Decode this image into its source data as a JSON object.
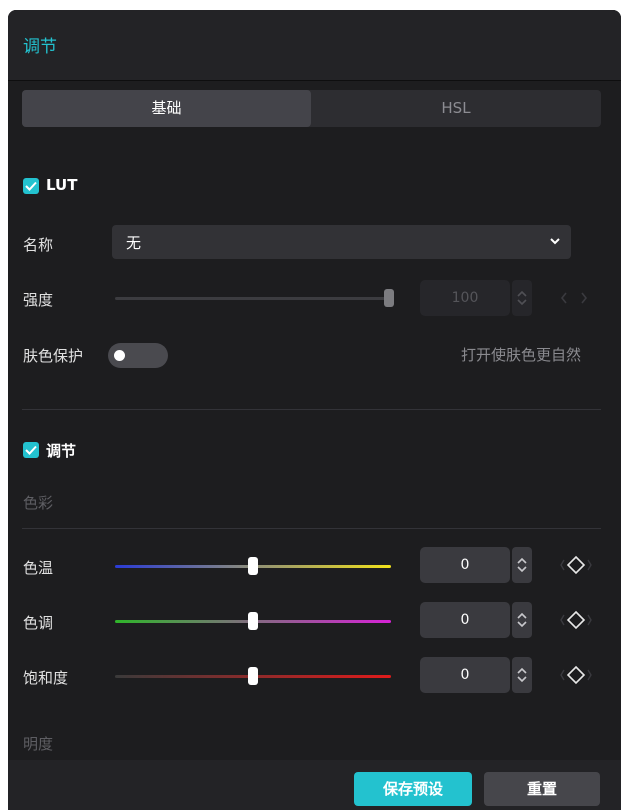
{
  "header": {
    "title": "调节"
  },
  "tabs": [
    {
      "label": "基础",
      "active": true
    },
    {
      "label": "HSL",
      "active": false
    }
  ],
  "lut": {
    "enabled": true,
    "section_title": "LUT",
    "name_label": "名称",
    "name_value": "无",
    "strength_label": "强度",
    "strength_value": "100",
    "strength_level": 1.0,
    "skin_label": "肤色保护",
    "skin_enabled": false,
    "skin_hint": "打开使肤色更自然"
  },
  "adjust": {
    "enabled": true,
    "section_title": "调节",
    "color_group_label": "色彩",
    "sliders": [
      {
        "label": "色温",
        "value": "0",
        "level": 0.5,
        "gradient": [
          "#2a3bd6",
          "#f2e21b"
        ]
      },
      {
        "label": "色调",
        "value": "0",
        "level": 0.5,
        "gradient": [
          "#2fb52a",
          "#d622d6"
        ]
      },
      {
        "label": "饱和度",
        "value": "0",
        "level": 0.5,
        "gradient": [
          "#3a3a3a",
          "#e01b1b"
        ]
      }
    ],
    "brightness_group_label": "明度"
  },
  "footer": {
    "save_label": "保存预设",
    "reset_label": "重置"
  },
  "colors": {
    "accent": "#23c2cf"
  }
}
